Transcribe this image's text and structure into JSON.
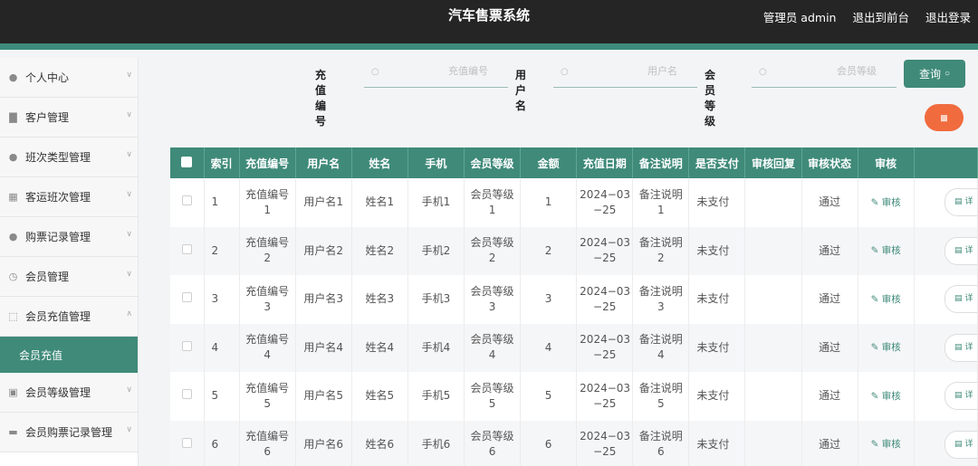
{
  "header": {
    "title": "汽车售票系统",
    "admin_label": "管理员 admin",
    "to_front": "退出到前台",
    "logout": "退出登录"
  },
  "sidebar": {
    "items": [
      {
        "label": "个人中心",
        "icon": "user-icon"
      },
      {
        "label": "客户管理",
        "icon": "chart-icon"
      },
      {
        "label": "班次类型管理",
        "icon": "user-icon"
      },
      {
        "label": "客运班次管理",
        "icon": "grid-icon"
      },
      {
        "label": "购票记录管理",
        "icon": "user-icon"
      },
      {
        "label": "会员管理",
        "icon": "clock-icon"
      },
      {
        "label": "会员充值管理",
        "icon": "expand-icon"
      }
    ],
    "active_sub": "会员充值",
    "items_after": [
      {
        "label": "会员等级管理",
        "icon": "clipboard-icon"
      },
      {
        "label": "会员购票记录管理",
        "icon": "message-icon"
      }
    ]
  },
  "search": {
    "field1_label": "充值编号",
    "field1_placeholder": "充值编号",
    "field2_label": "用户名",
    "field2_placeholder": "用户名",
    "field3_label": "会员等级",
    "field3_placeholder": "会员等级",
    "query_label": "查询"
  },
  "table": {
    "columns": [
      "索引",
      "充值编号",
      "用户名",
      "姓名",
      "手机",
      "会员等级",
      "金额",
      "充值日期",
      "备注说明",
      "是否支付",
      "审核回复",
      "审核状态",
      "审核"
    ],
    "audit_link": "审核",
    "detail_label": "详",
    "rows": [
      {
        "index": "1",
        "cz1": "充值编号",
        "cz2": "1",
        "user": "用户名1",
        "name": "姓名1",
        "phone": "手机1",
        "lv1": "会员等级",
        "lv2": "1",
        "amount": "1",
        "d1": "2024−03",
        "d2": "−25",
        "n1": "备注说明",
        "n2": "1",
        "paid": "未支付",
        "reply": "",
        "status": "通过"
      },
      {
        "index": "2",
        "cz1": "充值编号",
        "cz2": "2",
        "user": "用户名2",
        "name": "姓名2",
        "phone": "手机2",
        "lv1": "会员等级",
        "lv2": "2",
        "amount": "2",
        "d1": "2024−03",
        "d2": "−25",
        "n1": "备注说明",
        "n2": "2",
        "paid": "未支付",
        "reply": "",
        "status": "通过"
      },
      {
        "index": "3",
        "cz1": "充值编号",
        "cz2": "3",
        "user": "用户名3",
        "name": "姓名3",
        "phone": "手机3",
        "lv1": "会员等级",
        "lv2": "3",
        "amount": "3",
        "d1": "2024−03",
        "d2": "−25",
        "n1": "备注说明",
        "n2": "3",
        "paid": "未支付",
        "reply": "",
        "status": "通过"
      },
      {
        "index": "4",
        "cz1": "充值编号",
        "cz2": "4",
        "user": "用户名4",
        "name": "姓名4",
        "phone": "手机4",
        "lv1": "会员等级",
        "lv2": "4",
        "amount": "4",
        "d1": "2024−03",
        "d2": "−25",
        "n1": "备注说明",
        "n2": "4",
        "paid": "未支付",
        "reply": "",
        "status": "通过"
      },
      {
        "index": "5",
        "cz1": "充值编号",
        "cz2": "5",
        "user": "用户名5",
        "name": "姓名5",
        "phone": "手机5",
        "lv1": "会员等级",
        "lv2": "5",
        "amount": "5",
        "d1": "2024−03",
        "d2": "−25",
        "n1": "备注说明",
        "n2": "5",
        "paid": "未支付",
        "reply": "",
        "status": "通过"
      },
      {
        "index": "6",
        "cz1": "充值编号",
        "cz2": "6",
        "user": "用户名6",
        "name": "姓名6",
        "phone": "手机6",
        "lv1": "会员等级",
        "lv2": "6",
        "amount": "6",
        "d1": "2024−03",
        "d2": "−25",
        "n1": "备注说明",
        "n2": "6",
        "paid": "未支付",
        "reply": "",
        "status": "通过"
      }
    ]
  },
  "colors": {
    "accent": "#3f8a79",
    "header_bg": "#252525",
    "delete": "#f06b3e"
  }
}
